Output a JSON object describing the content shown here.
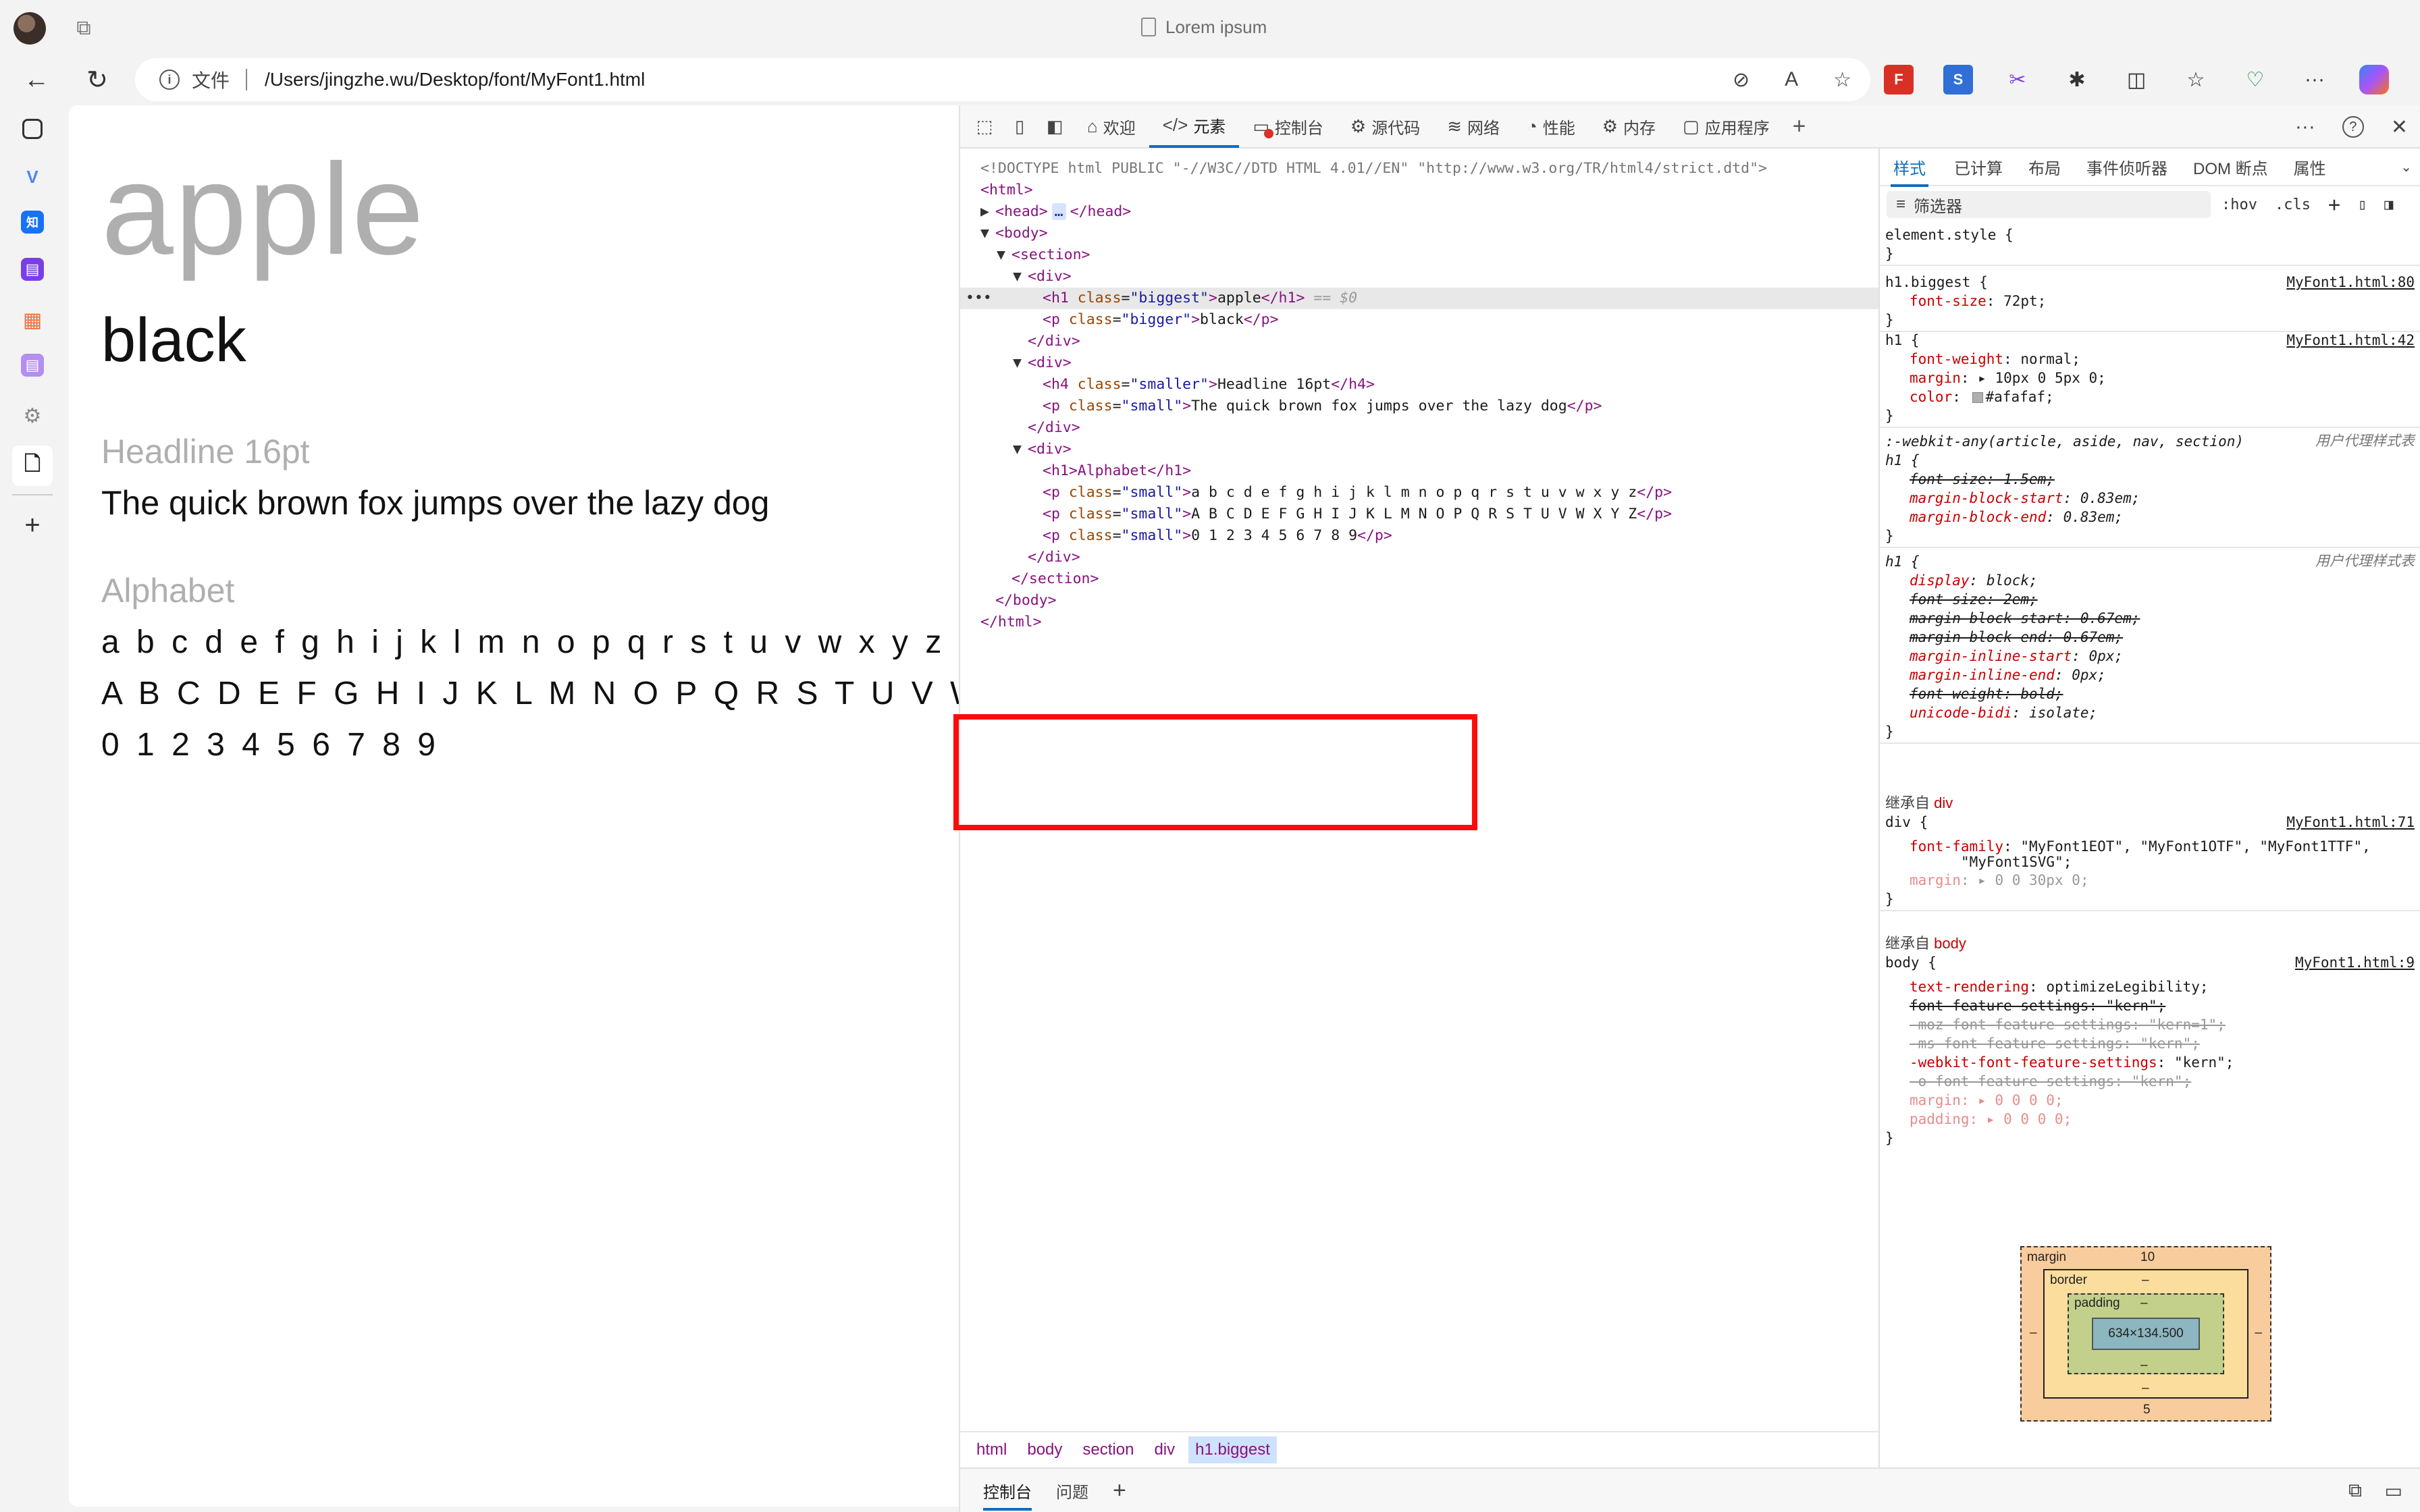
{
  "browser": {
    "window_title": "Lorem ipsum",
    "file_label": "文件",
    "url": "/Users/jingzhe.wu/Desktop/font/MyFont1.html",
    "icons": [
      "profile-avatar",
      "tab-actions-icon",
      "back-icon",
      "refresh-icon",
      "info-icon",
      "tracking-prevention-icon",
      "read-aloud-icon",
      "favorite-star-icon",
      "extension-icon",
      "split-screen-icon",
      "favorites-icon",
      "browser-essentials-icon",
      "more-icon",
      "copilot-icon"
    ],
    "read_aloud_glyph": "A",
    "more_glyph": "···"
  },
  "sidebar": {
    "items": [
      {
        "name": "tab-list-icon",
        "glyph": "▣"
      },
      {
        "name": "v-icon",
        "glyph": "V"
      },
      {
        "name": "zhihu-icon",
        "glyph": "知"
      },
      {
        "name": "notes-icon",
        "glyph": "▤"
      },
      {
        "name": "office-icon",
        "glyph": "▦"
      },
      {
        "name": "purple-notes-icon",
        "glyph": "▤"
      },
      {
        "name": "settings-icon",
        "glyph": "⚙"
      },
      {
        "name": "document-icon",
        "glyph": "🗋"
      },
      {
        "name": "add-icon",
        "glyph": "+"
      }
    ]
  },
  "page": {
    "h1_biggest": "apple",
    "p_bigger": "black",
    "h4_smaller": "Headline 16pt",
    "p_small": "The quick brown fox jumps over the lazy dog",
    "h1_alphabet": "Alphabet",
    "lower": "a b c d e f g h i j k l m n o p q r s t u v w x y z",
    "upper": "A B C D E F G H I J K L M N O P Q R S T U V W X Y Z",
    "digits": "0 1 2 3 4 5 6 7 8 9"
  },
  "devtools": {
    "tabs": [
      {
        "label": "欢迎",
        "glyph": "⌂"
      },
      {
        "label": "元素",
        "glyph": "</>"
      },
      {
        "label": "控制台",
        "glyph": "▭"
      },
      {
        "label": "源代码",
        "glyph": "⚙"
      },
      {
        "label": "网络",
        "glyph": "≋"
      },
      {
        "label": "性能",
        "glyph": "◔"
      },
      {
        "label": "内存",
        "glyph": "⚙"
      },
      {
        "label": "应用程序",
        "glyph": "▢"
      }
    ],
    "add_tab": "+",
    "right_glyphs": {
      "more": "···",
      "help": "?",
      "close": "✕"
    },
    "dom": {
      "doctype": "<!DOCTYPE html PUBLIC \"-//W3C//DTD HTML 4.01//EN\" \"http://www.w3.org/TR/html4/strict.dtd\">",
      "selected_marker": "== $0",
      "dots": "•••",
      "html_open": "<html>",
      "head_open": "<head>",
      "head_close": "</head>",
      "body_open": "<body>",
      "section_open": "<section>",
      "div_open": "<div>",
      "div_close": "</div>",
      "section_close": "</section>",
      "body_close": "</body>",
      "html_close": "</html>",
      "h1_open": "<h1",
      "h1_close": "</h1>",
      "p_open": "<p",
      "p_close": "</p>",
      "h4_open": "<h4",
      "h4_close": "</h4>",
      "class_attr": "class",
      "class_biggest": "\"biggest\"",
      "class_bigger": "\"bigger\"",
      "class_smaller": "\"smaller\"",
      "class_small": "\"small\"",
      "text_apple": "apple",
      "text_black": "black",
      "text_headline": "Headline 16pt",
      "text_quick": "The quick brown fox jumps over the lazy dog",
      "h1_alphabet_line": "<h1>Alphabet</h1>",
      "text_lower": "a b c d e f g h i j k l m n o p q r s t u v w x y z",
      "text_upper": "A B C D E F G H I J K L M N O P Q R S T U V W X Y Z",
      "text_digits": "0 1 2 3 4 5 6 7 8 9"
    },
    "breadcrumbs": [
      "html",
      "body",
      "section",
      "div",
      "h1.biggest"
    ],
    "drawer_tabs": [
      "控制台",
      "问题"
    ],
    "drawer_add": "+",
    "styles_tabs": [
      "样式",
      "已计算",
      "布局",
      "事件侦听器",
      "DOM 断点",
      "属性"
    ],
    "filter_placeholder": "筛选器",
    "filter_buttons": [
      ":hov",
      ".cls",
      "+"
    ],
    "rules": {
      "element_style": "element.style {",
      "close": "}",
      "h1_biggest_sel": "h1.biggest {",
      "h1_biggest_src": "MyFont1.html:80",
      "font_size_prop": "font-size",
      "font_size_val": "72pt;",
      "h1_sel": "h1 {",
      "h1_src": "MyFont1.html:42",
      "font_weight_prop": "font-weight",
      "font_weight_val": "normal;",
      "margin_prop": "margin",
      "margin_val": "10px 0 5px 0;",
      "color_prop": "color",
      "color_val": "#afafaf;",
      "webkit_any_sel": ":-webkit-any(article, aside, nav, section)",
      "webkit_any_sel2": "h1 {",
      "ua_label": "用户代理样式表",
      "ua_fs": "font-size: 1.5em;",
      "ua_mbs": "margin-block-start",
      "ua_mbs_val": "0.83em;",
      "ua_mbe": "margin-block-end",
      "ua_mbe_val": "0.83em;",
      "ua2_display": "display",
      "ua2_display_val": "block;",
      "ua2_fs": "font-size: 2em;",
      "ua2_mbs": "margin-block-start: 0.67em;",
      "ua2_mbe": "margin-block-end: 0.67em;",
      "ua2_mis": "margin-inline-start",
      "ua2_mis_val": "0px;",
      "ua2_mie": "margin-inline-end",
      "ua2_mie_val": "0px;",
      "ua2_fw": "font-weight: bold;",
      "ua2_ub": "unicode-bidi",
      "ua2_ub_val": "isolate;",
      "inherit_label": "继承自",
      "inherit_div": "div",
      "div_sel": "div {",
      "div_src": "MyFont1.html:71",
      "ff_prop": "font-family",
      "ff_val": "\"MyFont1EOT\", \"MyFont1OTF\", \"MyFont1TTF\",",
      "ff_val2": "\"MyFont1SVG\";",
      "div_margin_prop": "margin",
      "div_margin_val": "0 0 30px 0;",
      "inherit_body": "body",
      "body_sel": "body {",
      "body_src": "MyFont1.html:9",
      "tr_prop": "text-rendering",
      "tr_val": "optimizeLegibility;",
      "ffs": "font-feature-settings: \"kern\";",
      "moz_ffs": "-moz-font-feature-settings: \"kern=1\";",
      "ms_ffs": "-ms-font-feature-settings: \"kern\";",
      "wk_ffs_prop": "-webkit-font-feature-settings",
      "wk_ffs_val": "\"kern\";",
      "o_ffs": "-o-font-feature-settings: \"kern\";",
      "body_margin": "margin: ▸ 0 0 0 0;",
      "body_padding": "padding: ▸ 0 0 0 0;"
    },
    "box_model": {
      "margin_label": "margin",
      "margin_top": "10",
      "margin_bottom": "5",
      "margin_side": "–",
      "border_label": "border",
      "border_val": "–",
      "padding_label": "padding",
      "padding_val": "–",
      "content": "634×134.500"
    }
  },
  "colors": {
    "accent": "#0f6cbd",
    "highlight_box": "#ff0a0a",
    "heading_gray": "#afafaf"
  }
}
